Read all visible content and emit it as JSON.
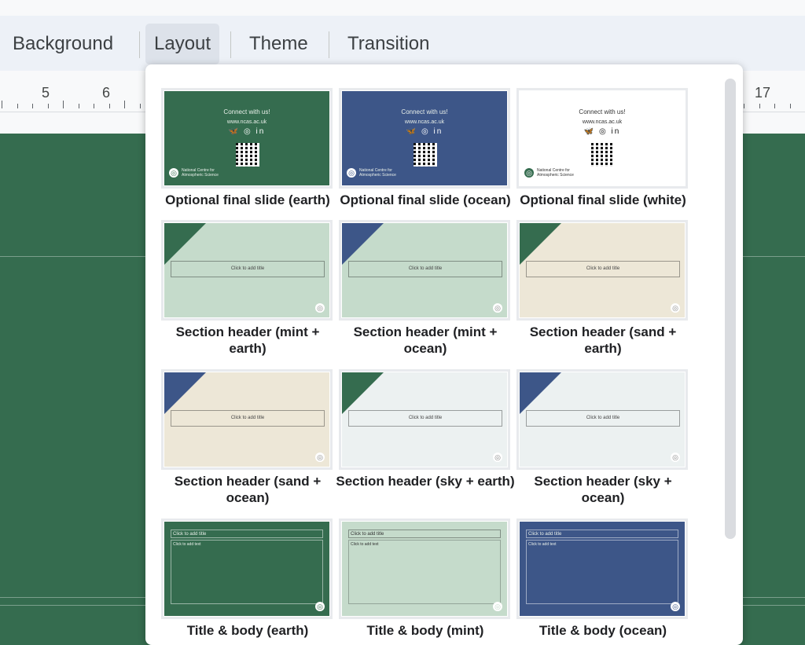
{
  "toolbar": {
    "background_label": "Background",
    "layout_label": "Layout",
    "theme_label": "Theme",
    "transition_label": "Transition"
  },
  "ruler": {
    "labels": [
      "5",
      "6",
      "17"
    ]
  },
  "colors": {
    "earth": "#356c4f",
    "ocean": "#3d5688",
    "mint": "#c5dbcb",
    "sand": "#ede7d7",
    "sky": "#ecf1f1",
    "white": "#ffffff"
  },
  "layouts": [
    {
      "label": "Optional final slide (earth)",
      "kind": "final",
      "bg": "earth"
    },
    {
      "label": "Optional final slide (ocean)",
      "kind": "final",
      "bg": "ocean"
    },
    {
      "label": "Optional final slide (white)",
      "kind": "final",
      "bg": "white"
    },
    {
      "label": "Section header (mint + earth)",
      "kind": "section",
      "bg": "mint",
      "accent": "earth"
    },
    {
      "label": "Section header (mint + ocean)",
      "kind": "section",
      "bg": "mint",
      "accent": "ocean"
    },
    {
      "label": "Section header (sand + earth)",
      "kind": "section",
      "bg": "sand",
      "accent": "earth"
    },
    {
      "label": "Section header (sand + ocean)",
      "kind": "section",
      "bg": "sand",
      "accent": "ocean"
    },
    {
      "label": "Section header (sky + earth)",
      "kind": "section",
      "bg": "sky",
      "accent": "earth"
    },
    {
      "label": "Section header (sky + ocean)",
      "kind": "section",
      "bg": "sky",
      "accent": "ocean"
    },
    {
      "label": "Title & body (earth)",
      "kind": "titlebody",
      "bg": "earth"
    },
    {
      "label": "Title & body (mint)",
      "kind": "titlebody",
      "bg": "mint"
    },
    {
      "label": "Title & body (ocean)",
      "kind": "titlebody",
      "bg": "ocean"
    }
  ],
  "thumb_text": {
    "connect": "Connect with us!",
    "url": "www.ncas.ac.uk",
    "social_icons": "🦋 ◎ in",
    "org": "National Centre for Atmospheric Science",
    "title_placeholder": "Click to add title",
    "body_placeholder": "Click to add text",
    "logo_glyph": "◎"
  }
}
